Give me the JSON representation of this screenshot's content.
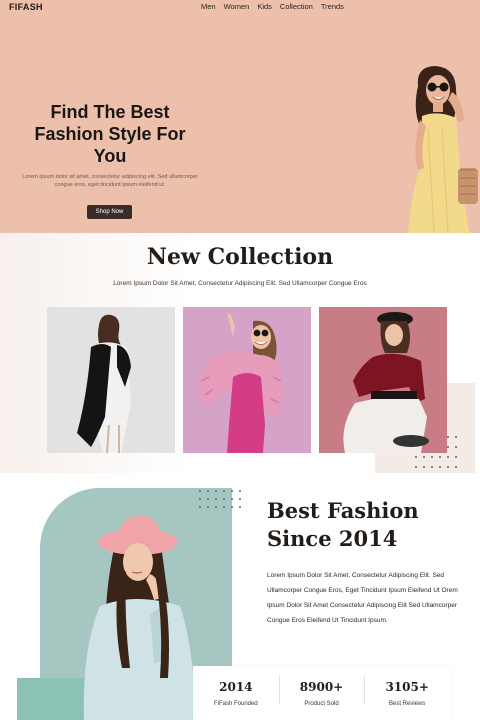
{
  "brand": "FIFASH",
  "nav": [
    "Men",
    "Women",
    "Kids",
    "Collection",
    "Trends"
  ],
  "hero": {
    "title": "Find The Best Fashion Style For You",
    "subtitle": "Lorem ipsum dolor sit amet, consectetur adipiscing elit. Sed ullamcorper congue eros, eget tincidunt ipsum eleifend ut.",
    "cta": "Shop Now"
  },
  "collection": {
    "title": "New Collection",
    "subtitle": "Lorem Ipsum Dolor Sit Amet, Consectetur Adipiscing Elit. Sed Ullamcorper Congue Eros"
  },
  "about": {
    "title_line1": "Best Fashion",
    "title_line2": "Since 2014",
    "text": "Lorem Ipsum Dolor Sit Amet, Consectetur Adipiscing Elit. Sed Ullamcorper Congue Eros, Eget Tincidunt Ipsum Eleifend Ut Orem Ipsum Dolor Sit Amet Consectetur Adipiscing Elit Sed Ullamcorper Congue Eros Eleifend Ut Tincidunt Ipsum.",
    "stats": [
      {
        "value": "2014",
        "label": "FiFash Founded"
      },
      {
        "value": "8900+",
        "label": "Product Sold"
      },
      {
        "value": "3105+",
        "label": "Best Reviews"
      }
    ]
  },
  "colors": {
    "hero_bg": "#edc0ac",
    "button_bg": "#3a2c26",
    "teal": "#a6c6c1",
    "card1_bg": "#e2e2e2",
    "card2_bg": "#d6a3c8",
    "card3_bg": "#c87c86"
  }
}
